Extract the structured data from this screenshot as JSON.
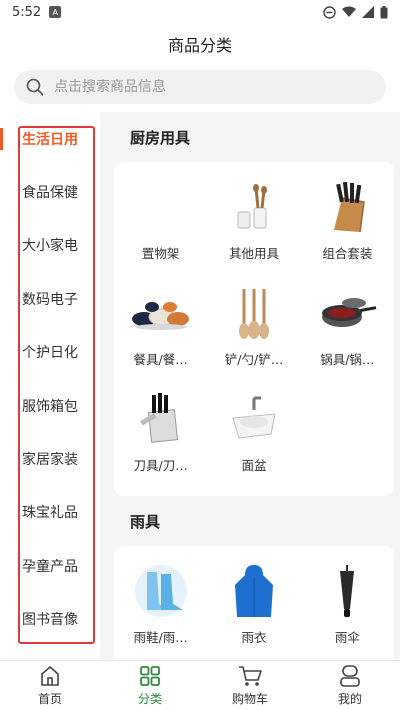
{
  "status": {
    "time": "5:52",
    "notif_glyph": "A"
  },
  "header": {
    "title": "商品分类"
  },
  "search": {
    "placeholder": "点击搜索商品信息"
  },
  "sidebar": {
    "items": [
      {
        "label": "生活日用",
        "active": true
      },
      {
        "label": "食品保健"
      },
      {
        "label": "大小家电"
      },
      {
        "label": "数码电子"
      },
      {
        "label": "个护日化"
      },
      {
        "label": "服饰箱包"
      },
      {
        "label": "家居家装"
      },
      {
        "label": "珠宝礼品"
      },
      {
        "label": "孕童产品"
      },
      {
        "label": "图书音像"
      }
    ]
  },
  "sections": [
    {
      "title": "厨房用具",
      "items": [
        {
          "label": "置物架",
          "icon": "rack-icon"
        },
        {
          "label": "其他用具",
          "icon": "kitchen-utensils-icon"
        },
        {
          "label": "组合套装",
          "icon": "knife-block-icon"
        },
        {
          "label": "餐具/餐…",
          "icon": "tableware-icon"
        },
        {
          "label": "铲/勺/铲…",
          "icon": "spatula-icon"
        },
        {
          "label": "锅具/锅…",
          "icon": "pot-icon"
        },
        {
          "label": "刀具/刀…",
          "icon": "knife-set-icon"
        },
        {
          "label": "面盆",
          "icon": "basin-icon"
        }
      ]
    },
    {
      "title": "雨具",
      "items": [
        {
          "label": "雨鞋/雨…",
          "icon": "rain-boots-icon"
        },
        {
          "label": "雨衣",
          "icon": "raincoat-icon"
        },
        {
          "label": "雨伞",
          "icon": "umbrella-icon"
        }
      ]
    }
  ],
  "bottom_nav": {
    "items": [
      {
        "label": "首页",
        "icon": "home-icon"
      },
      {
        "label": "分类",
        "icon": "category-icon",
        "active": true
      },
      {
        "label": "购物车",
        "icon": "cart-icon"
      },
      {
        "label": "我的",
        "icon": "profile-icon"
      }
    ]
  },
  "colors": {
    "accent": "#f05a24",
    "nav_active": "#2e8b3d",
    "highlight_box": "#e53935"
  }
}
